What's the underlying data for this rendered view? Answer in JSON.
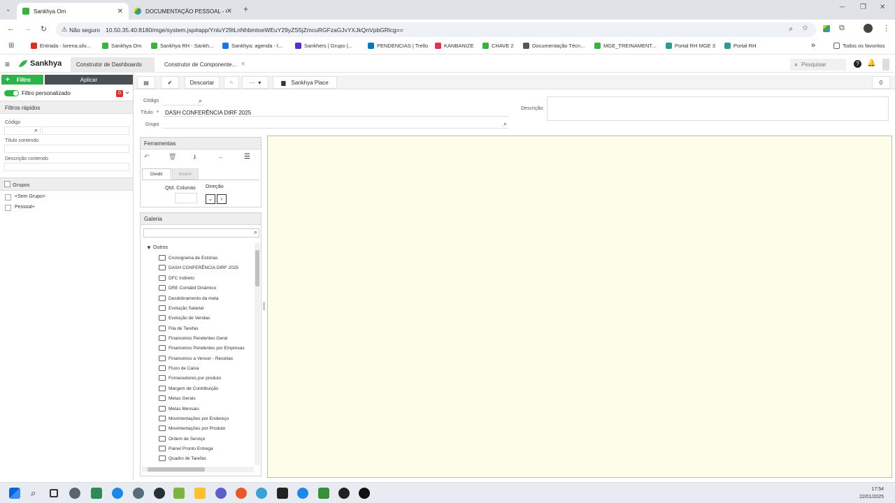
{
  "browser": {
    "tabs": [
      {
        "title": "Sankhya Om",
        "active": true
      },
      {
        "title": "DOCUMENTAÇÃO PESSOAL - G",
        "active": false
      }
    ],
    "new_tab": "+",
    "security": "Não seguro",
    "url": "10.50.35.40:8180/mge/system.jsp#app/YnluY29tLnNhbmtoeWEuY29yZS5jZmcuRGFzaGJvYXJkQnVpbGRlcg==",
    "bookmarks": [
      "Entrada - lorena.silv...",
      "Sankhya Om",
      "Sankhya RH - Sankh...",
      "Sankhya: agenda - l...",
      "Sankhers | Grupo |...",
      "PENDENCIAS | Trello",
      "KANBANIZE",
      "CHAVE 2",
      "Documentação Técn...",
      "MGE_TREINAMENT...",
      "Portal RH MGE 3",
      "Portal RH"
    ],
    "more_bookmarks": "»",
    "all_favorites": "Todos os favoritos"
  },
  "app": {
    "brand": "Sankhya",
    "tabs": [
      "Construtor de Dashboards",
      "Construtor de Componente..."
    ],
    "search_placeholder": "Pesquisar"
  },
  "left": {
    "filtro": "Filtro",
    "aplicar": "Aplicar",
    "filtro_personalizado": "Filtro personalizado",
    "badge": "0",
    "filtros_rapidos": "Filtros rápidos",
    "codigo": "Código",
    "titulo_contendo": "Título contendo",
    "descricao_contendo": "Descrição contendo",
    "grupos": "Grupos",
    "group_items": [
      "<Sem Grupo>",
      "Pessoal+"
    ]
  },
  "toolbar": {
    "descartar": "Descartar",
    "sankhya_place": "Sankhya Place",
    "counter": "0"
  },
  "form": {
    "codigo": "Código",
    "titulo": "Título",
    "titulo_value": "DASH CONFERÊNCIA DIRF 2025",
    "grupo": "Grupo",
    "descricao": "Descrição:"
  },
  "ferramentas": {
    "title": "Ferramentas",
    "subtabs": [
      "Dividir",
      "Inserir"
    ],
    "qtd_colunas": "Qtd. Colunas",
    "direcao": "Direção"
  },
  "galeria": {
    "title": "Galeria",
    "folder": "Outros",
    "items": [
      "Cronograma de Estórias",
      "DASH CONFERÊNCIA DIRF 2025",
      "DFC Indireto",
      "DRE Contábil Dinâmico",
      "Desdobramento da meta",
      "Evolução Salarial",
      "Evolução de Vendas",
      "Fila de Tarefas",
      "Financeiros Pendentes Geral",
      "Financeiros Pendentes por Empresas",
      "Financeiros a Vencer - Receitas",
      "Fluxo de Caixa",
      "Fornecedores por produto",
      "Margem de Contribuição",
      "Metas Gerais",
      "Metas Mensais",
      "Movimentações por Endereço",
      "Movimentações por Produto",
      "Ordem de Serviço",
      "Painel Pronto Entrega",
      "Quadro de Tarefas"
    ]
  },
  "taskbar": {
    "time": "17:54",
    "date": "22/01/2025"
  },
  "colors": {
    "green": "#2db34a",
    "dark": "#4a4f56",
    "canvas": "#fefde9",
    "badge": "#d9342b"
  }
}
